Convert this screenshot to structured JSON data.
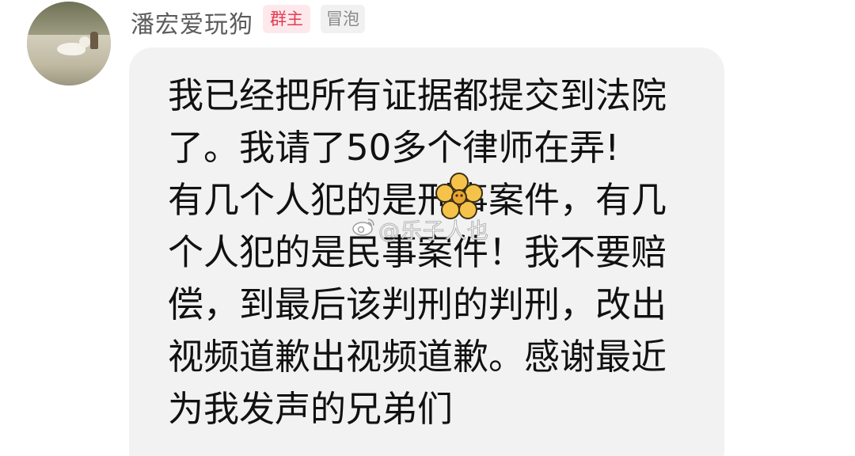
{
  "post": {
    "username": "潘宏爱玩狗",
    "badge_owner": "群主",
    "badge_bubble": "冒泡",
    "message": "我已经把所有证据都提交到法院\n了。我请了50多个律师在弄!\n有几个人犯的是刑事案件，有几\n个人犯的是民事案件！我不要赔\n偿，到最后该判刑的判刑，改出\n视频道歉出视频道歉。感谢最近\n为我发声的兄弟们"
  },
  "watermark": {
    "text": "@乐子人也",
    "icon": "weibo-logo-icon",
    "sticker": "flower-sticker-icon"
  },
  "colors": {
    "bubble_bg": "#f2f2f2",
    "owner_badge_text": "#e43b53",
    "owner_badge_bg": "#fde9ec",
    "bubble_badge_bg": "#f1f1f1",
    "username_text": "#5c5c5c",
    "message_text": "#111111"
  }
}
